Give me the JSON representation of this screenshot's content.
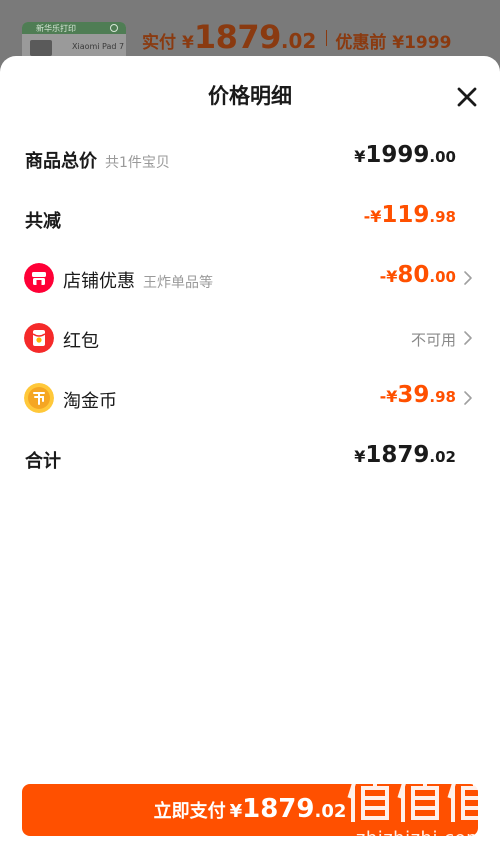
{
  "background": {
    "thumbnail_band": "新华乐打印",
    "thumbnail_label": "Xiaomi Pad 7",
    "paid_label": "实付",
    "paid_currency": "¥",
    "paid_integer": "1879",
    "paid_decimal": ".02",
    "before_label": "优惠前 ¥1999"
  },
  "sheet": {
    "title": "价格明细"
  },
  "rows": {
    "total": {
      "label": "商品总价",
      "sub": "共1件宝贝",
      "currency": "¥",
      "integer": "1999",
      "decimal": ".00"
    },
    "reduction": {
      "label": "共减",
      "currency": "-¥",
      "integer": "119",
      "decimal": ".98"
    },
    "shop": {
      "label": "店铺优惠",
      "sub": "王炸单品等",
      "currency": "-¥",
      "integer": "80",
      "decimal": ".00"
    },
    "redpacket": {
      "label": "红包",
      "status": "不可用"
    },
    "coin": {
      "label": "淘金币",
      "currency": "-¥",
      "integer": "39",
      "decimal": ".98"
    },
    "sum": {
      "label": "合计",
      "currency": "¥",
      "integer": "1879",
      "decimal": ".02"
    }
  },
  "pay_button": {
    "label": "立即支付",
    "currency": "¥",
    "integer": "1879",
    "decimal": ".02"
  },
  "watermark": {
    "text": "zhizhizhi.com"
  },
  "colors": {
    "accent": "#ff5000",
    "shop_icon": "#ff0036",
    "coin_icon": "#ffc83a"
  },
  "icons": [
    "close-icon",
    "shop-icon",
    "red-packet-icon",
    "coin-icon",
    "chevron-right-icon"
  ]
}
